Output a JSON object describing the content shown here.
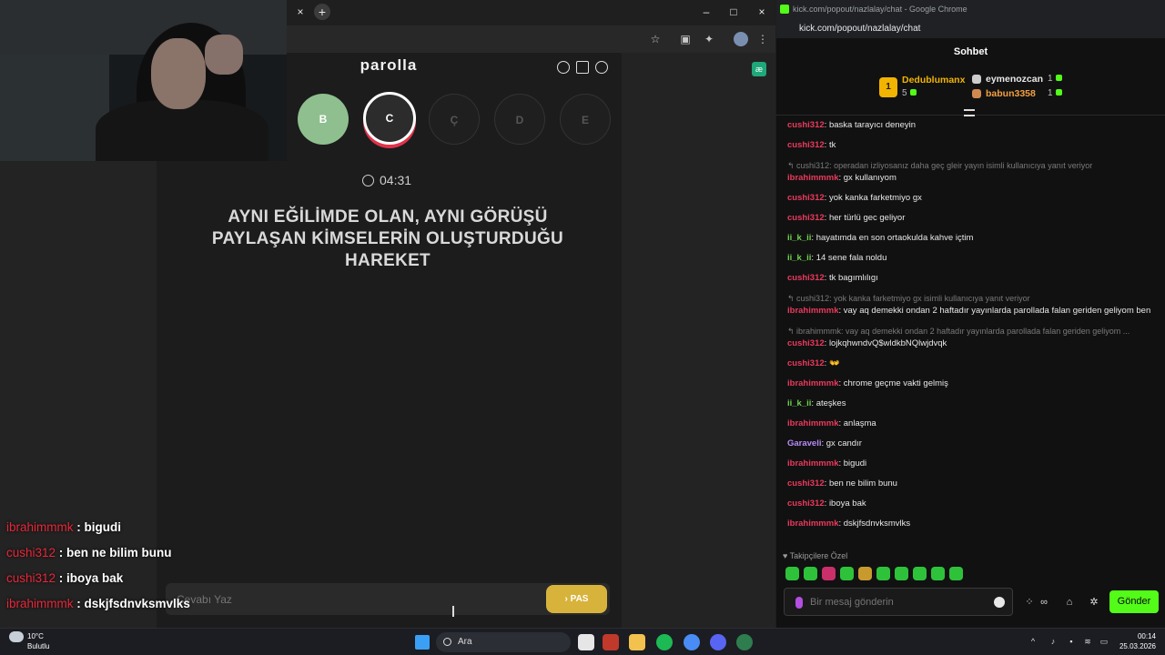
{
  "left_window": {
    "tab_close": "×",
    "tab_new": "+",
    "controls": {
      "minimize": "–",
      "maximize": "□",
      "close": "×"
    }
  },
  "game": {
    "title": "parolla",
    "letters": [
      {
        "label": "B",
        "state": "done"
      },
      {
        "label": "C",
        "state": "active"
      },
      {
        "label": "Ç",
        "state": "waiting"
      },
      {
        "label": "D",
        "state": "waiting"
      },
      {
        "label": "E",
        "state": "waiting"
      }
    ],
    "timer": "04:31",
    "question": "AYNI EĞİLİMDE OLAN, AYNI GÖRÜŞÜ PAYLAŞAN KİMSELERİN OLUŞTURDUĞU HAREKET",
    "answer_placeholder": "Cevabı Yaz",
    "pass_label": "› PAS"
  },
  "overlay_chat": [
    {
      "user": "ibrahimmmk",
      "text": " : bigudi"
    },
    {
      "user": "cushi312",
      "text": " : ben ne bilim bunu"
    },
    {
      "user": "cushi312",
      "text": " : iboya bak"
    },
    {
      "user": "ibrahimmmk",
      "text": " : dskjfsdnvksmvlks"
    }
  ],
  "chat_window": {
    "title": "kick.com/popout/nazlalay/chat - Google Chrome",
    "url": "kick.com/popout/nazlalay/chat",
    "header": "Sohbet",
    "leaderboard": [
      {
        "rank": "1",
        "name": "Dedublumanx",
        "count": "5"
      },
      {
        "name": "eymenozcan",
        "count": "1"
      },
      {
        "name": "babun3358",
        "count": "1"
      }
    ],
    "messages": [
      {
        "user": "cushi312",
        "color": "red",
        "text": ": baska tarayıcı deneyin"
      },
      {
        "user": "cushi312",
        "color": "red",
        "text": ": tk"
      },
      {
        "reply": "↰ cushi312: operadan izliyosanız daha geç gleir yayın isimli kullanıcıya yanıt veriyor",
        "user": "ibrahimmmk",
        "color": "red",
        "text": ": gx kullanıyom"
      },
      {
        "user": "cushi312",
        "color": "red",
        "text": ": yok kanka farketmiyo gx"
      },
      {
        "user": "cushi312",
        "color": "red",
        "text": ": her türlü gec geliyor"
      },
      {
        "user": "ii_k_ii",
        "color": "green",
        "text": ": hayatımda en son ortaokulda kahve içtim"
      },
      {
        "user": "ii_k_ii",
        "color": "green",
        "text": ": 14 sene fala noldu"
      },
      {
        "user": "cushi312",
        "color": "red",
        "text": ": tk bagımlılıgı"
      },
      {
        "reply": "↰ cushi312: yok kanka farketmiyo gx isimli kullanıcıya yanıt veriyor",
        "user": "ibrahimmmk",
        "color": "red",
        "text": ": vay aq demekki ondan 2 haftadır yayınlarda parollada falan geriden geliyom ben"
      },
      {
        "reply": "↰ ibrahimmmk: vay aq demekki ondan 2 haftadır yayınlarda parollada falan geriden geliyom ...",
        "user": "cushi312",
        "color": "red",
        "text": ": lojkqhwndvQ$wldkbNQlwjdvqk"
      },
      {
        "user": "cushi312",
        "color": "red",
        "text": ": 👐"
      },
      {
        "user": "ibrahimmmk",
        "color": "red",
        "text": ": chrome geçme vakti gelmiş"
      },
      {
        "user": "ii_k_ii",
        "color": "green",
        "text": ": ateşkes"
      },
      {
        "user": "ibrahimmmk",
        "color": "red",
        "text": ": anlaşma"
      },
      {
        "user": "Garaveli",
        "color": "purple",
        "text": ": gx candır"
      },
      {
        "user": "ibrahimmmk",
        "color": "red",
        "text": ": bigudi"
      },
      {
        "user": "cushi312",
        "color": "red",
        "text": ": ben ne bilim bunu"
      },
      {
        "user": "cushi312",
        "color": "red",
        "text": ": iboya bak"
      },
      {
        "user": "ibrahimmmk",
        "color": "red",
        "text": ": dskjfsdnvksmvlks"
      }
    ],
    "follow_only": "♥ Takipçilere Özel",
    "input_placeholder": "Bir mesaj gönderin",
    "send_label": "Gönder"
  },
  "taskbar": {
    "temp": "10°C",
    "weather": "Bulutlu",
    "search_label": "Ara",
    "time": "00:14",
    "date": "25.03.2026"
  },
  "colors": {
    "kick_green": "#53fc18",
    "user_red": "#ea3a5a",
    "user_green": "#6fd24a",
    "user_purple": "#b88cf5",
    "pass_yellow": "#d8b33c",
    "done_green": "#8fbf8f"
  }
}
